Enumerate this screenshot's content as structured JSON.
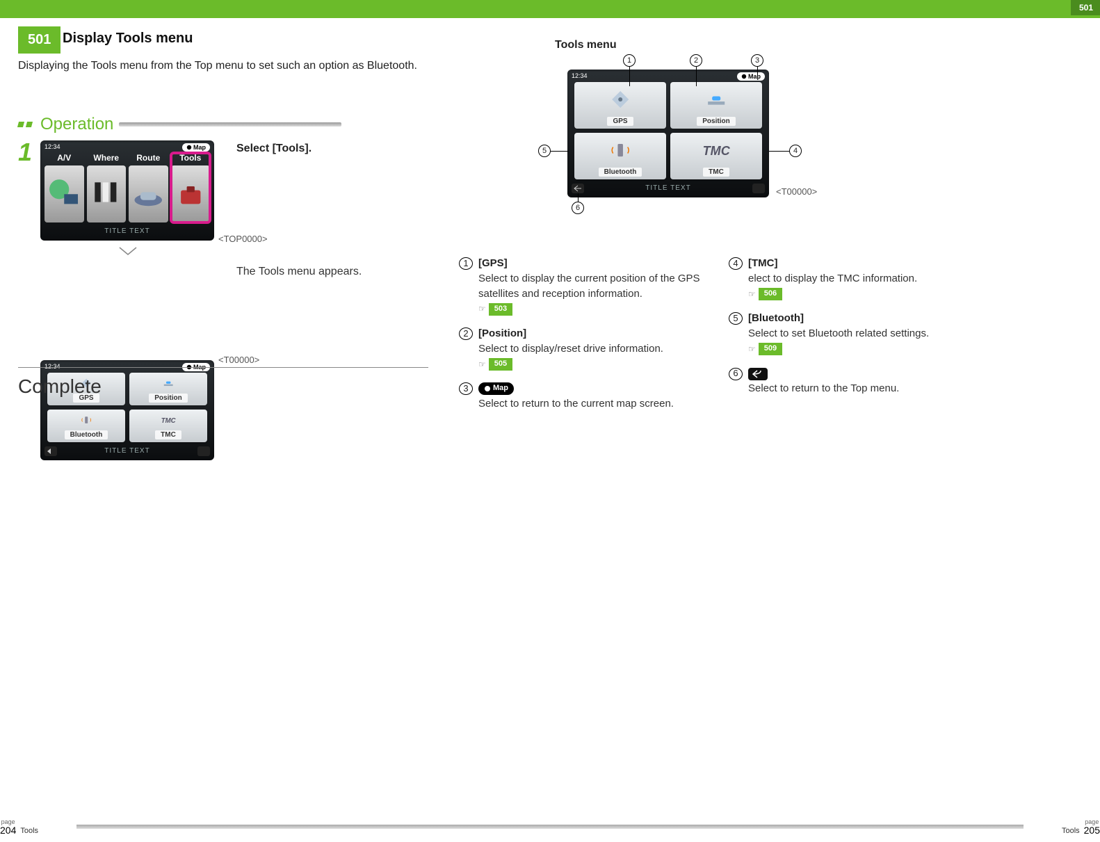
{
  "header": {
    "corner_num": "501",
    "badge": "501",
    "title": "Display Tools menu",
    "subtitle": "Displaying the Tools menu from the Top menu to set such an option as Bluetooth."
  },
  "operation": {
    "label": "Operation",
    "step_num": "1",
    "step_text": "Select [Tools].",
    "top_screen": {
      "time": "12:34",
      "map_btn": "Map",
      "items": [
        "A/V",
        "Where",
        "Route",
        "Tools"
      ],
      "title_text": "TITLE TEXT",
      "caption": "<TOP0000>"
    },
    "result_text": "The Tools menu appears.",
    "tools_screen": {
      "time": "12:34",
      "map_btn": "Map",
      "tiles": [
        "GPS",
        "Position",
        "Bluetooth",
        "TMC"
      ],
      "title_text": "TITLE TEXT",
      "caption": "<T00000>"
    },
    "complete": "Complete"
  },
  "right": {
    "title": "Tools menu",
    "big_screen": {
      "time": "12:34",
      "map_btn": "Map",
      "tiles": [
        "GPS",
        "Position",
        "Bluetooth",
        "TMC"
      ],
      "title_text": "TITLE TEXT",
      "caption": "<T00000>"
    },
    "callouts": [
      "1",
      "2",
      "3",
      "4",
      "5",
      "6"
    ],
    "items_left": [
      {
        "n": "1",
        "hd": "[GPS]",
        "tx": "Select to display the current position of the GPS satellites and reception information.",
        "ref": "503"
      },
      {
        "n": "2",
        "hd": "[Position]",
        "tx": "Select to display/reset drive information.",
        "ref": "505"
      },
      {
        "n": "3",
        "hd_pill": "Map",
        "tx": "Select to return to the current map screen."
      }
    ],
    "items_right": [
      {
        "n": "4",
        "hd": "[TMC]",
        "tx": "elect to display the TMC information.",
        "ref": "506"
      },
      {
        "n": "5",
        "hd": "[Bluetooth]",
        "tx": "Select to set Bluetooth related settings.",
        "ref": "509"
      },
      {
        "n": "6",
        "back": true,
        "tx": "Select to return to the Top menu."
      }
    ]
  },
  "footer": {
    "left_section": "Tools",
    "left_page": "204",
    "right_section": "Tools",
    "right_page": "205",
    "page_word": "page"
  }
}
